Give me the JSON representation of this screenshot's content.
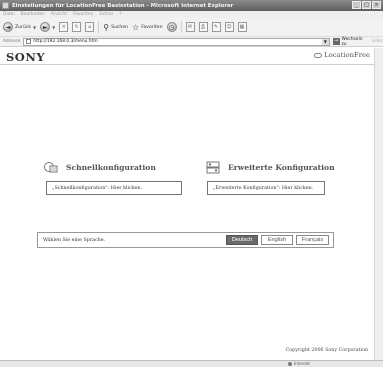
{
  "window": {
    "title": "Einstellungen für LocationFree Basisstation - Microsoft Internet Explorer",
    "controls": [
      "_",
      "□",
      "×"
    ]
  },
  "menu": [
    "Datei",
    "Bearbeiten",
    "Ansicht",
    "Favoriten",
    "Extras",
    "?"
  ],
  "toolbar": {
    "back_label": "Zurück",
    "search_label": "Suchen",
    "favorites_label": "Favoriten"
  },
  "addressbar": {
    "label": "Adresse",
    "url": "http://192.168.0.3/menu.htm",
    "go_label": "Wechseln zu",
    "links_label": "Links"
  },
  "header": {
    "brand": "SONY",
    "product": "LocationFree"
  },
  "quick_setup": {
    "title": "Schnellkonfiguration",
    "link_text": "„Schnellkonfiguration\": Hier klicken."
  },
  "advanced_setup": {
    "title": "Erweiterte Konfiguration",
    "link_text": "„Erweiterte Konfiguration\": Hier klicken."
  },
  "language": {
    "prompt": "Wählen Sie eine Sprache.",
    "options": [
      "Deutsch",
      "English",
      "Français"
    ],
    "selected": "Deutsch"
  },
  "footer": {
    "copyright": "Copyright 2006 Sony Corporation"
  },
  "statusbar": {
    "zone": "Internet"
  },
  "colors": {
    "titlebar": "#6e6e6e",
    "selected_button": "#6b6b6b"
  }
}
